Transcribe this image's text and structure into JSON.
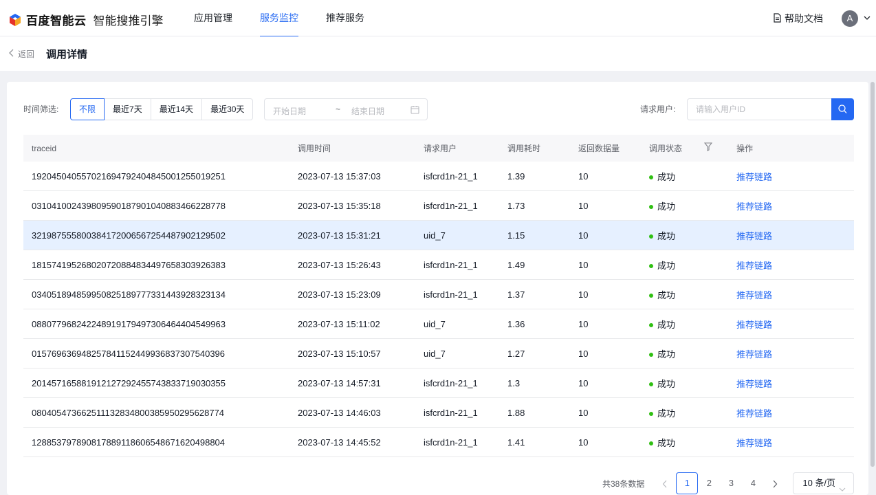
{
  "header": {
    "brand": "百度智能云",
    "product": "智能搜推引擎",
    "nav": [
      {
        "label": "应用管理",
        "active": false
      },
      {
        "label": "服务监控",
        "active": true
      },
      {
        "label": "推荐服务",
        "active": false
      }
    ],
    "help_label": "帮助文档",
    "avatar_letter": "A"
  },
  "subheader": {
    "back_label": "返回",
    "title": "调用详情"
  },
  "filters": {
    "time_label": "时间筛选:",
    "time_options": [
      "不限",
      "最近7天",
      "最近14天",
      "最近30天"
    ],
    "time_selected": "不限",
    "date_start_placeholder": "开始日期",
    "date_separator": "~",
    "date_end_placeholder": "结束日期",
    "user_label": "请求用户:",
    "user_placeholder": "请输入用户ID",
    "user_value": ""
  },
  "table": {
    "columns": [
      "traceid",
      "调用时间",
      "请求用户",
      "调用耗时",
      "返回数据量",
      "调用状态",
      "操作"
    ],
    "highlighted_row": 2,
    "rows": [
      {
        "traceid": "1920450405570216947924048450012550192 51",
        "time": "2023-07-13 15:37:03",
        "user": "isfcrd1n-21_1",
        "cost": "1.39",
        "count": "10",
        "status": "成功",
        "action": "推荐链路"
      },
      {
        "traceid": "031041002439809590187901040883466228778",
        "time": "2023-07-13 15:35:18",
        "user": "isfcrd1n-21_1",
        "cost": "1.73",
        "count": "10",
        "status": "成功",
        "action": "推荐链路"
      },
      {
        "traceid": "321987555800384172006567254487902129502",
        "time": "2023-07-13 15:31:21",
        "user": "uid_7",
        "cost": "1.15",
        "count": "10",
        "status": "成功",
        "action": "推荐链路"
      },
      {
        "traceid": "181574195268020720884834497658303926383",
        "time": "2023-07-13 15:26:43",
        "user": "isfcrd1n-21_1",
        "cost": "1.49",
        "count": "10",
        "status": "成功",
        "action": "推荐链路"
      },
      {
        "traceid": "034051894859950825189777331443928323134",
        "time": "2023-07-13 15:23:09",
        "user": "isfcrd1n-21_1",
        "cost": "1.37",
        "count": "10",
        "status": "成功",
        "action": "推荐链路"
      },
      {
        "traceid": "088077968242248919179497306464404549963",
        "time": "2023-07-13 15:11:02",
        "user": "uid_7",
        "cost": "1.36",
        "count": "10",
        "status": "成功",
        "action": "推荐链路"
      },
      {
        "traceid": "015769636948257841152449936837307540396",
        "time": "2023-07-13 15:10:57",
        "user": "uid_7",
        "cost": "1.27",
        "count": "10",
        "status": "成功",
        "action": "推荐链路"
      },
      {
        "traceid": "201457165881912127292455743833719030355",
        "time": "2023-07-13 14:57:31",
        "user": "isfcrd1n-21_1",
        "cost": "1.3",
        "count": "10",
        "status": "成功",
        "action": "推荐链路"
      },
      {
        "traceid": "080405473662511132834800385950295628774",
        "time": "2023-07-13 14:46:03",
        "user": "isfcrd1n-21_1",
        "cost": "1.88",
        "count": "10",
        "status": "成功",
        "action": "推荐链路"
      },
      {
        "traceid": "128853797890817889118606548671620498804",
        "time": "2023-07-13 14:45:52",
        "user": "isfcrd1n-21_1",
        "cost": "1.41",
        "count": "10",
        "status": "成功",
        "action": "推荐链路"
      }
    ]
  },
  "pagination": {
    "total_label": "共38条数据",
    "pages": [
      "1",
      "2",
      "3",
      "4"
    ],
    "current_page": "1",
    "page_size_label": "10 条/页"
  },
  "colors": {
    "accent": "#2468f2",
    "success": "#30bf13",
    "highlight_row": "#e6f0ff"
  }
}
